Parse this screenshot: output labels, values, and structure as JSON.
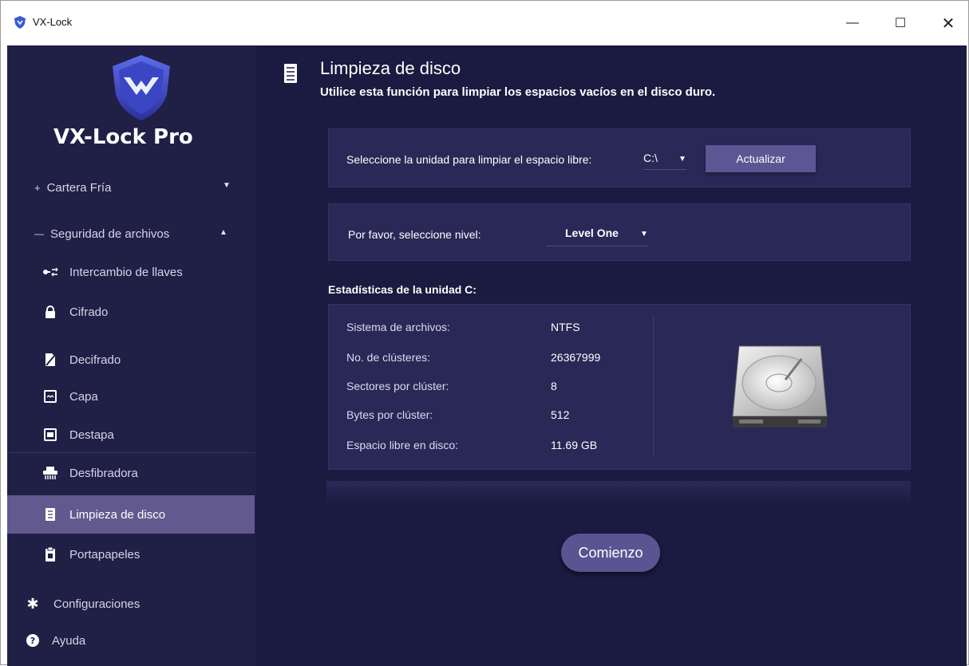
{
  "window": {
    "title": "VX-Lock",
    "controls": {
      "minimize": "—",
      "maximize": "☐",
      "close": "✕"
    }
  },
  "sidebar": {
    "brand": "VX-Lock Pro",
    "groups": {
      "cold_wallet": {
        "prefix": "+",
        "label": "Cartera Fría"
      },
      "file_security": {
        "prefix": "—",
        "label": "Seguridad de archivos"
      }
    },
    "items": [
      {
        "label": "Intercambio de llaves",
        "icon": "key-exchange-icon"
      },
      {
        "label": "Cifrado",
        "icon": "lock-icon"
      },
      {
        "label": "Decifrado",
        "icon": "unlock-file-icon"
      },
      {
        "label": "Capa",
        "icon": "layer-icon"
      },
      {
        "label": "Destapa",
        "icon": "uncover-icon"
      },
      {
        "label": "Desfibradora",
        "icon": "shredder-icon"
      },
      {
        "label": "Limpieza de disco",
        "icon": "disk-clean-icon",
        "active": true
      },
      {
        "label": "Portapapeles",
        "icon": "clipboard-icon"
      }
    ],
    "bottom": [
      {
        "label": "Configuraciones",
        "icon": "gear-icon"
      },
      {
        "label": "Ayuda",
        "icon": "help-icon"
      }
    ]
  },
  "main": {
    "title": "Limpieza de disco",
    "subtitle": "Utilice esta función para limpiar los espacios vacíos en el disco duro.",
    "drive_panel": {
      "label": "Seleccione la unidad para limpiar el espacio libre:",
      "selected": "C:\\",
      "button": "Actualizar"
    },
    "level_panel": {
      "label": "Por favor, seleccione nivel:",
      "selected": "Level One"
    },
    "stats": {
      "heading": "Estadísticas de la unidad C:",
      "rows": [
        {
          "label": "Sistema de archivos:",
          "value": "NTFS"
        },
        {
          "label": "No. de clústeres:",
          "value": "26367999"
        },
        {
          "label": "Sectores por clúster:",
          "value": "8"
        },
        {
          "label": "Bytes por clúster:",
          "value": "512"
        },
        {
          "label": "Espacio libre en disco:",
          "value": "11.69 GB"
        }
      ]
    },
    "start_button": "Comienzo"
  },
  "colors": {
    "app_bg": "#1b1a40",
    "sidebar_bg": "#201f45",
    "panel_bg": "#2a2856",
    "accent": "#5c5694",
    "active_item": "#625a8e"
  }
}
